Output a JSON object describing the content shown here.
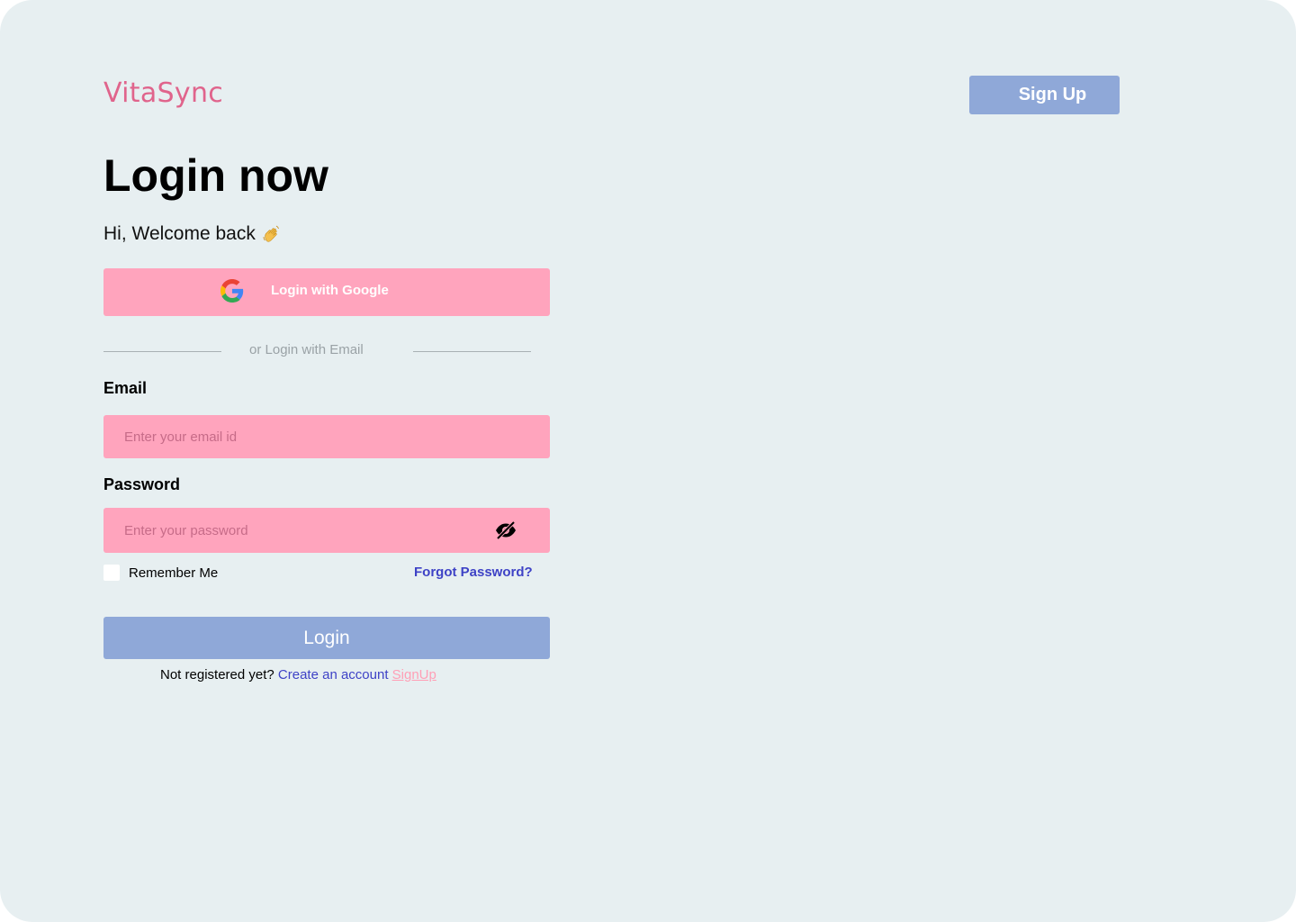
{
  "brand": {
    "logo_text": "VitaSync",
    "logo_color": "#e0648c"
  },
  "header": {
    "signup_label": "Sign Up"
  },
  "main": {
    "title": "Login now",
    "welcome_text": "Hi, Welcome back",
    "welcome_icon": "waving-hand-icon",
    "google_button_label": "Login with Google",
    "divider_text": "or Login with Email",
    "email": {
      "label": "Email",
      "placeholder": "Enter your email id",
      "value": ""
    },
    "password": {
      "label": "Password",
      "placeholder": "Enter your password",
      "value": "",
      "toggle_icon": "eye-off-icon"
    },
    "remember_label": "Remember Me",
    "remember_checked": false,
    "forgot_label": "Forgot Password?",
    "login_label": "Login",
    "register": {
      "prompt": "Not registered yet?",
      "create_label": "Create an account",
      "signup_label": "SignUp"
    }
  },
  "colors": {
    "background": "#e7eff1",
    "pink_field": "#ffa4bd",
    "blue_button": "#8fa8d8",
    "link_blue": "#3e42c6",
    "link_pink": "#ff9fb6"
  }
}
